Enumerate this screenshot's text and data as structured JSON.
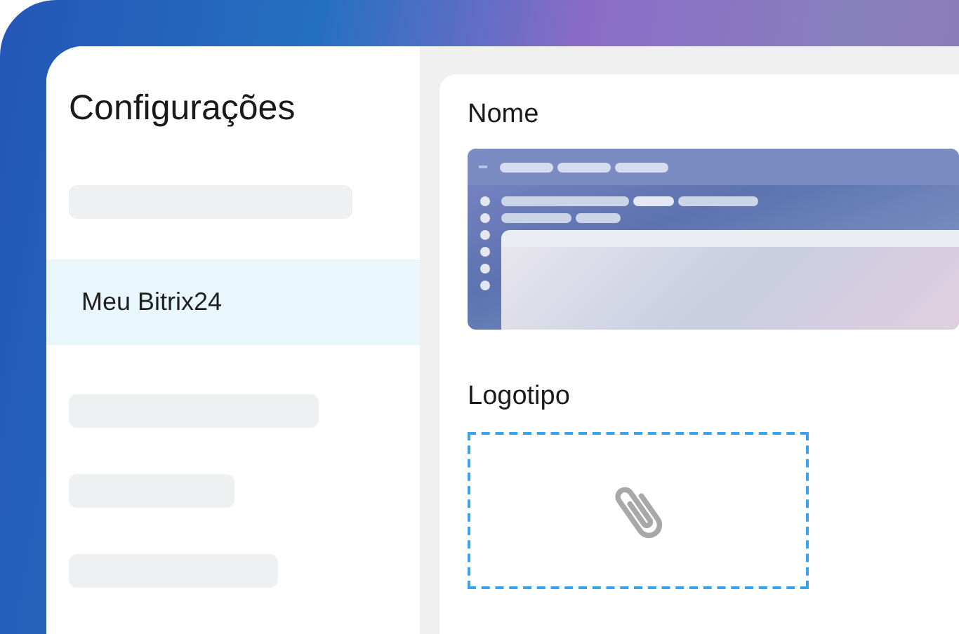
{
  "sidebar": {
    "title": "Configurações",
    "items": [
      {
        "kind": "placeholder",
        "selected": false
      },
      {
        "kind": "item",
        "label": "Meu Bitrix24",
        "selected": true
      },
      {
        "kind": "placeholder",
        "selected": false
      },
      {
        "kind": "placeholder",
        "selected": false
      },
      {
        "kind": "placeholder",
        "selected": false
      }
    ]
  },
  "content": {
    "sections": [
      {
        "kind": "preview",
        "label": "Nome"
      },
      {
        "kind": "upload",
        "label": "Logotipo"
      }
    ]
  }
}
